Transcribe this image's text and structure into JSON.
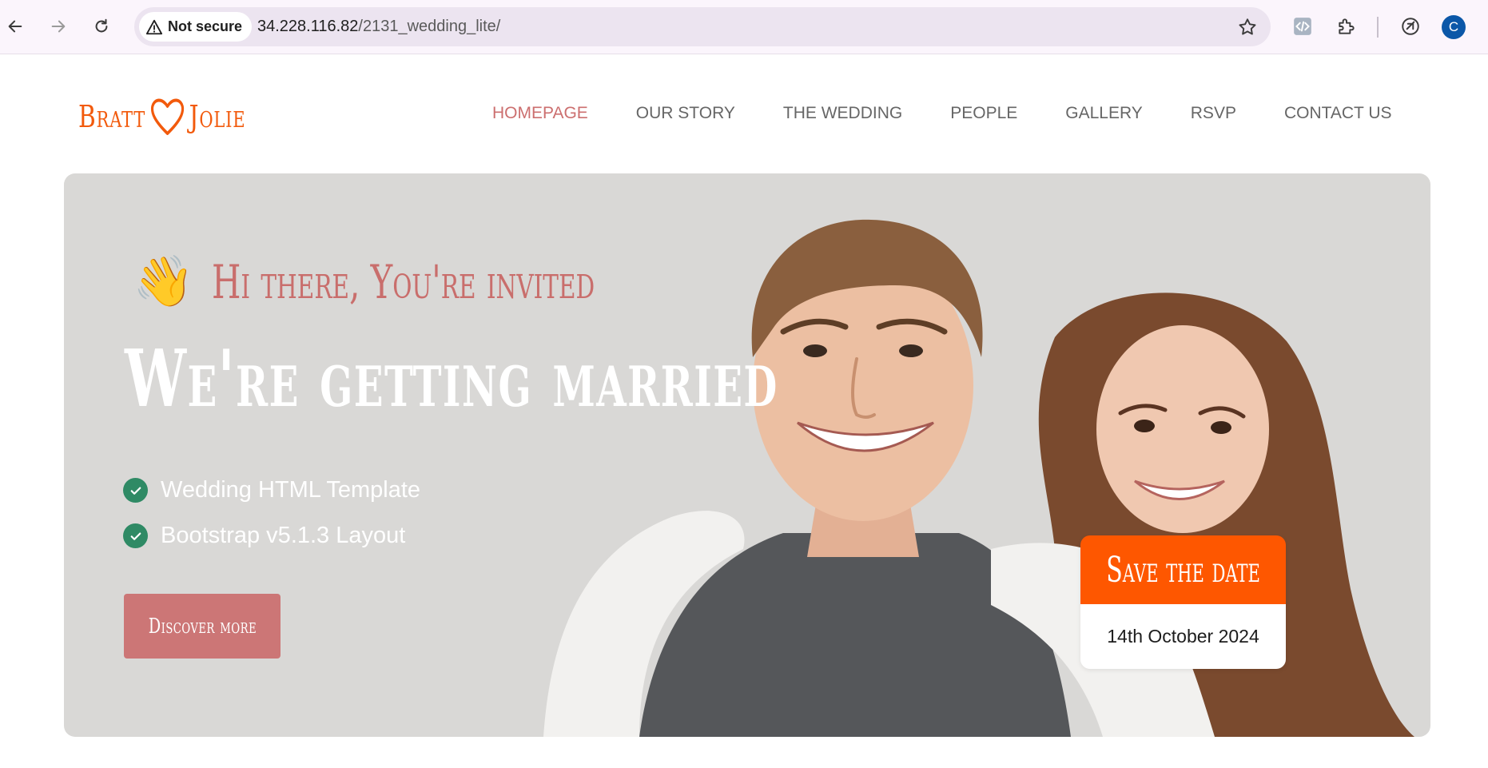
{
  "browser": {
    "security_label": "Not secure",
    "url_host": "34.228.116.82",
    "url_path": "/2131_wedding_lite/",
    "profile_initial": "C",
    "icons": [
      "back-arrow-icon",
      "forward-arrow-icon",
      "reload-icon",
      "warning-icon",
      "star-icon",
      "code-extension-icon",
      "puzzle-extensions-icon",
      "performance-icon"
    ]
  },
  "site": {
    "logo": {
      "left": "Bratt",
      "right": "Jolie",
      "color": "#f25a0c"
    },
    "nav": [
      {
        "label": "HOMEPAGE",
        "active": true
      },
      {
        "label": "OUR STORY",
        "active": false
      },
      {
        "label": "THE WEDDING",
        "active": false
      },
      {
        "label": "PEOPLE",
        "active": false
      },
      {
        "label": "GALLERY",
        "active": false
      },
      {
        "label": "RSVP",
        "active": false
      },
      {
        "label": "CONTACT US",
        "active": false
      }
    ],
    "hero": {
      "wave_emoji": "👋",
      "greeting": "Hi there, You're invited",
      "headline": "We're getting married",
      "features": [
        "Wedding HTML Template",
        "Bootstrap v5.1.3 Layout"
      ],
      "cta_label": "Discover more",
      "save_the_date": {
        "title": "Save the date",
        "date": "14th October 2024"
      }
    }
  },
  "colors": {
    "accent": "#cc6f6f",
    "orange": "#fe5700",
    "check_green": "#2f8a65",
    "hero_bg": "#d9d8d6"
  }
}
